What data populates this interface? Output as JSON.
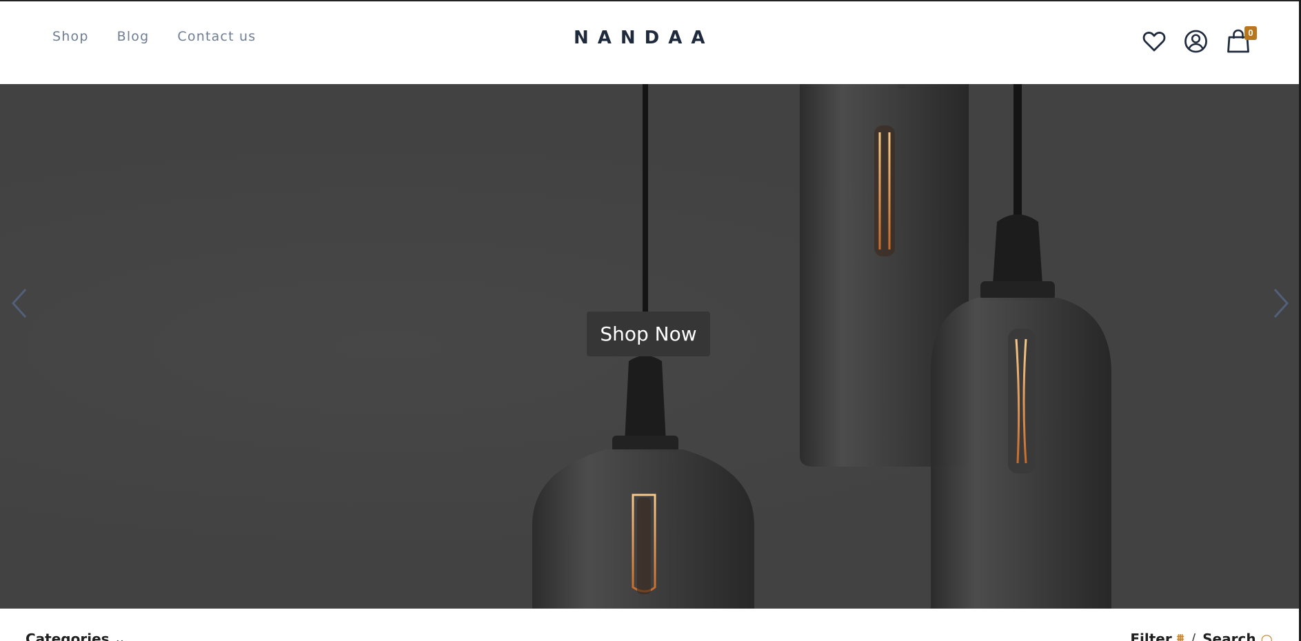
{
  "nav": {
    "items": [
      {
        "label": "Shop"
      },
      {
        "label": "Blog"
      },
      {
        "label": "Contact us"
      }
    ]
  },
  "brand": {
    "logo": "NANDAA"
  },
  "header_icons": {
    "wishlist": "heart-icon",
    "account": "user-circle-icon",
    "cart": "shopping-bag-icon",
    "cart_count": "0"
  },
  "hero": {
    "cta_label": "Shop Now",
    "prev_icon": "chevron-left-icon",
    "next_icon": "chevron-right-icon"
  },
  "toolbar": {
    "categories_label": "Categories",
    "categories_caret": "⌄",
    "filter_label": "Filter",
    "filter_icon": "⩩",
    "separator": "/",
    "search_label": "Search",
    "search_icon": "○"
  },
  "colors": {
    "accent": "#b8761d",
    "nav_text": "#6e7d92",
    "logo": "#1f2b3d",
    "hero_bg": "#424242",
    "button_bg": "#363636"
  }
}
